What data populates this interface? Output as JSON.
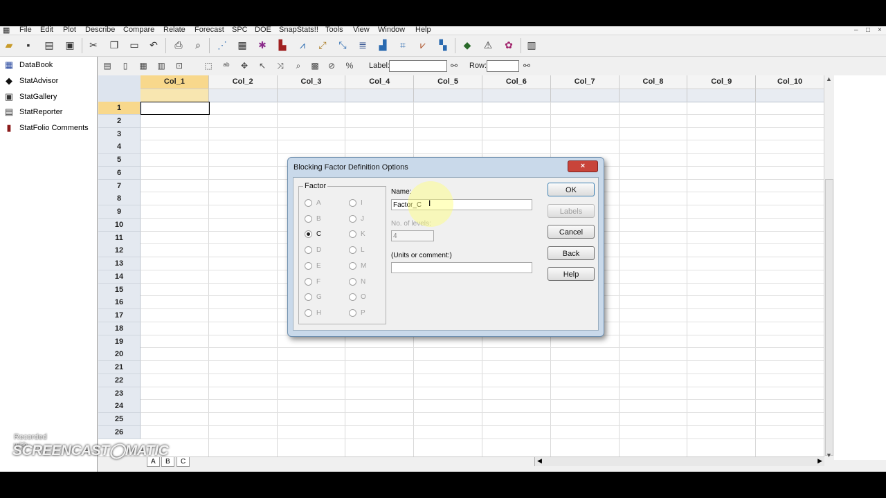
{
  "menu": [
    "File",
    "Edit",
    "Plot",
    "Describe",
    "Compare",
    "Relate",
    "Forecast",
    "SPC",
    "DOE",
    "SnapStats!!",
    "Tools",
    "View",
    "Window",
    "Help"
  ],
  "window_controls": [
    "–",
    "□",
    "×"
  ],
  "left_panel": [
    {
      "label": "DataBook",
      "icon": "databook-icon",
      "glyph": "▦",
      "color": "#2a4aa0"
    },
    {
      "label": "StatAdvisor",
      "icon": "statadvisor-icon",
      "glyph": "◆",
      "color": "#111111"
    },
    {
      "label": "StatGallery",
      "icon": "statgallery-icon",
      "glyph": "▣",
      "color": "#333333"
    },
    {
      "label": "StatReporter",
      "icon": "statreporter-icon",
      "glyph": "▤",
      "color": "#333333"
    },
    {
      "label": "StatFolio Comments",
      "icon": "statfolio-comments-icon",
      "glyph": "▮",
      "color": "#8a1a1a"
    }
  ],
  "toolbar2": {
    "label_text": "Label:",
    "row_text": "Row:",
    "label_value": "",
    "row_value": ""
  },
  "grid": {
    "columns": [
      "Col_1",
      "Col_2",
      "Col_3",
      "Col_4",
      "Col_5",
      "Col_6",
      "Col_7",
      "Col_8",
      "Col_9",
      "Col_10"
    ],
    "rows": [
      "1",
      "2",
      "3",
      "4",
      "5",
      "6",
      "7",
      "8",
      "9",
      "10",
      "11",
      "12",
      "13",
      "14",
      "15",
      "16",
      "17",
      "18",
      "19",
      "20",
      "21",
      "22",
      "23",
      "24",
      "25",
      "26"
    ],
    "selected_col": 0,
    "selected_row": 0
  },
  "sheet_tabs": [
    "A",
    "B",
    "C"
  ],
  "dialog": {
    "title": "Blocking Factor Definition Options",
    "close": "×",
    "factor_legend": "Factor",
    "factors_left": [
      "A",
      "B",
      "C",
      "D",
      "E",
      "F",
      "G",
      "H"
    ],
    "factors_right": [
      "I",
      "J",
      "K",
      "L",
      "M",
      "N",
      "O",
      "P"
    ],
    "selected_factor": "C",
    "name_label": "Name:",
    "name_value": "Factor_C",
    "levels_label": "No. of levels:",
    "levels_value": "4",
    "units_label": "(Units or comment:)",
    "units_value": "",
    "buttons": {
      "ok": "OK",
      "labels": "Labels",
      "cancel": "Cancel",
      "back": "Back",
      "help": "Help"
    }
  },
  "watermark": {
    "line1": "Recorded with",
    "line2": "SCREENCAST◯MATIC"
  }
}
